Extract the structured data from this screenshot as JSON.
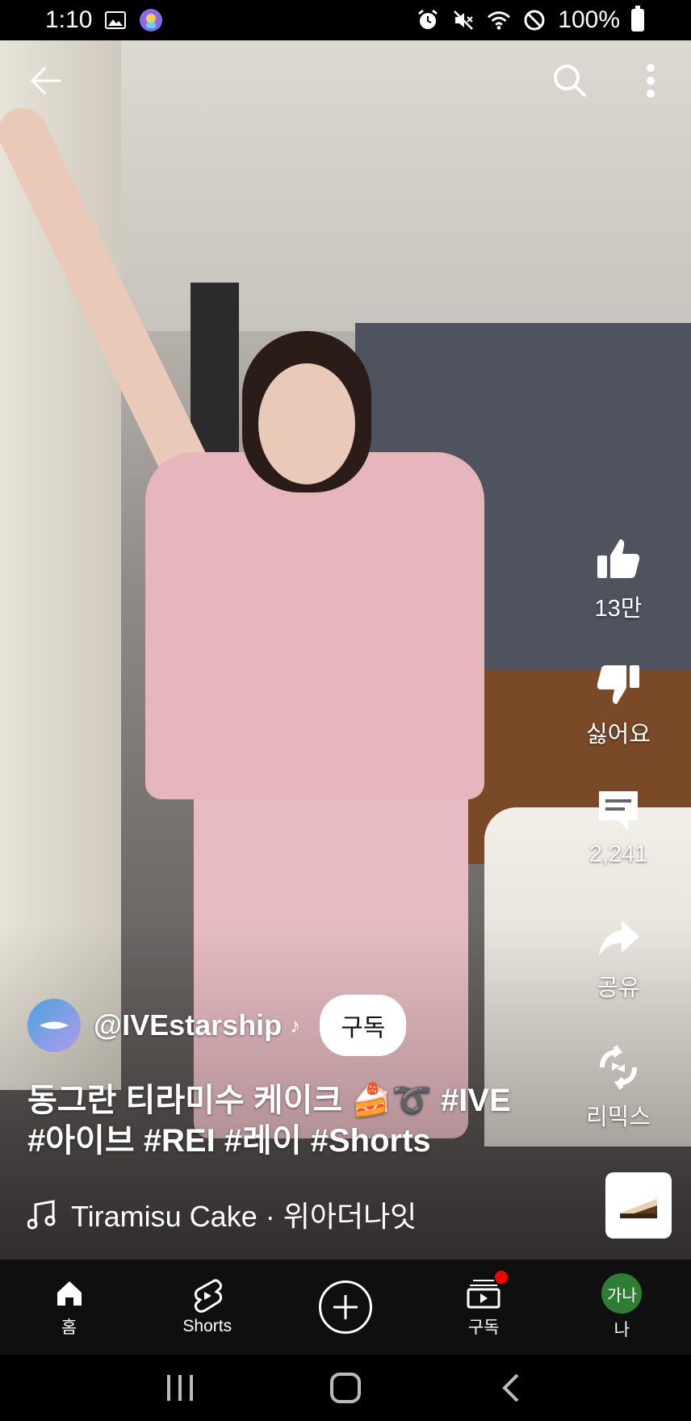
{
  "status_bar": {
    "time": "1:10",
    "battery": "100%"
  },
  "video": {
    "overlay_actions": [
      "back",
      "search",
      "more"
    ]
  },
  "actions": {
    "like_count": "13만",
    "dislike_label": "싫어요",
    "comment_count": "2,241",
    "share_label": "공유",
    "remix_label": "리믹스"
  },
  "channel": {
    "handle": "@IVEstarship",
    "subscribe_label": "구독"
  },
  "caption": {
    "line1": "동그란 티라미수 케이크 🍰➰ #IVE",
    "line2": "#아이브 #REI #레이 #Shorts"
  },
  "music": {
    "label": "Tiramisu Cake · 위아더나잇"
  },
  "bottom_nav": {
    "home": "홈",
    "shorts": "Shorts",
    "subscriptions": "구독",
    "me": "나",
    "me_avatar": "가나"
  },
  "colors": {
    "notification": "#ff0000",
    "me_avatar_bg": "#2e7d32",
    "nav_bg": "#0f0f0f"
  }
}
